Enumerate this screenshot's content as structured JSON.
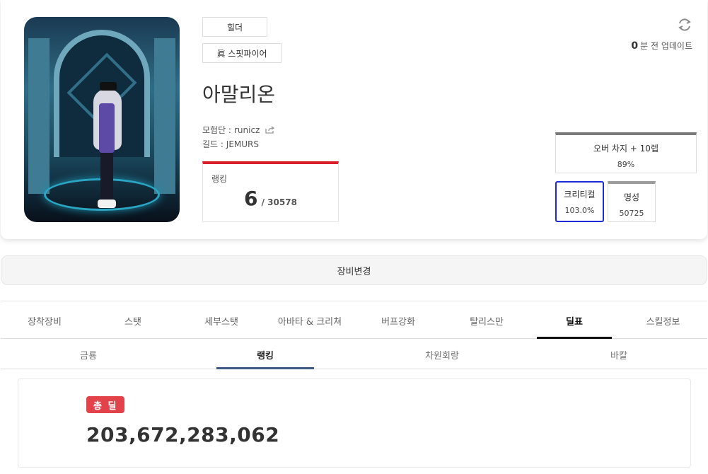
{
  "character": {
    "job": "힐더",
    "advancement": "眞 스핏파이어",
    "name": "아말리온",
    "adventure_label": "모험단 :",
    "adventure_name": "runicz",
    "guild_label": "길드 :",
    "guild_name": "JEMURS"
  },
  "ranking": {
    "label": "랭킹",
    "rank": "6",
    "total": "/ 30578"
  },
  "update": {
    "minutes": "0",
    "text": "분 전 업데이트"
  },
  "stats": {
    "overcharge_label": "오버 차지 + 10렙",
    "overcharge_value": "89%",
    "crit_label": "크리티컬",
    "crit_value": "103.0%",
    "fame_label": "명성",
    "fame_value": "50725"
  },
  "equip_change_label": "장비변경",
  "main_tabs": [
    {
      "label": "장착장비"
    },
    {
      "label": "스탯"
    },
    {
      "label": "세부스탯"
    },
    {
      "label": "아바타 & 크리쳐"
    },
    {
      "label": "버프강화"
    },
    {
      "label": "탈리스만"
    },
    {
      "label": "딜표",
      "active": true
    },
    {
      "label": "스킬정보"
    }
  ],
  "sub_tabs": [
    {
      "label": "금룡"
    },
    {
      "label": "랭킹",
      "active": true
    },
    {
      "label": "차원회랑"
    },
    {
      "label": "바칼"
    }
  ],
  "damage": {
    "badge": "총 딜",
    "value": "203,672,283,062"
  },
  "colors": {
    "rank_accent": "#d91e2b",
    "crit_border": "#1c2bd6",
    "damage_badge": "#e2434b",
    "sub_tab_underline": "#3d5a85"
  }
}
